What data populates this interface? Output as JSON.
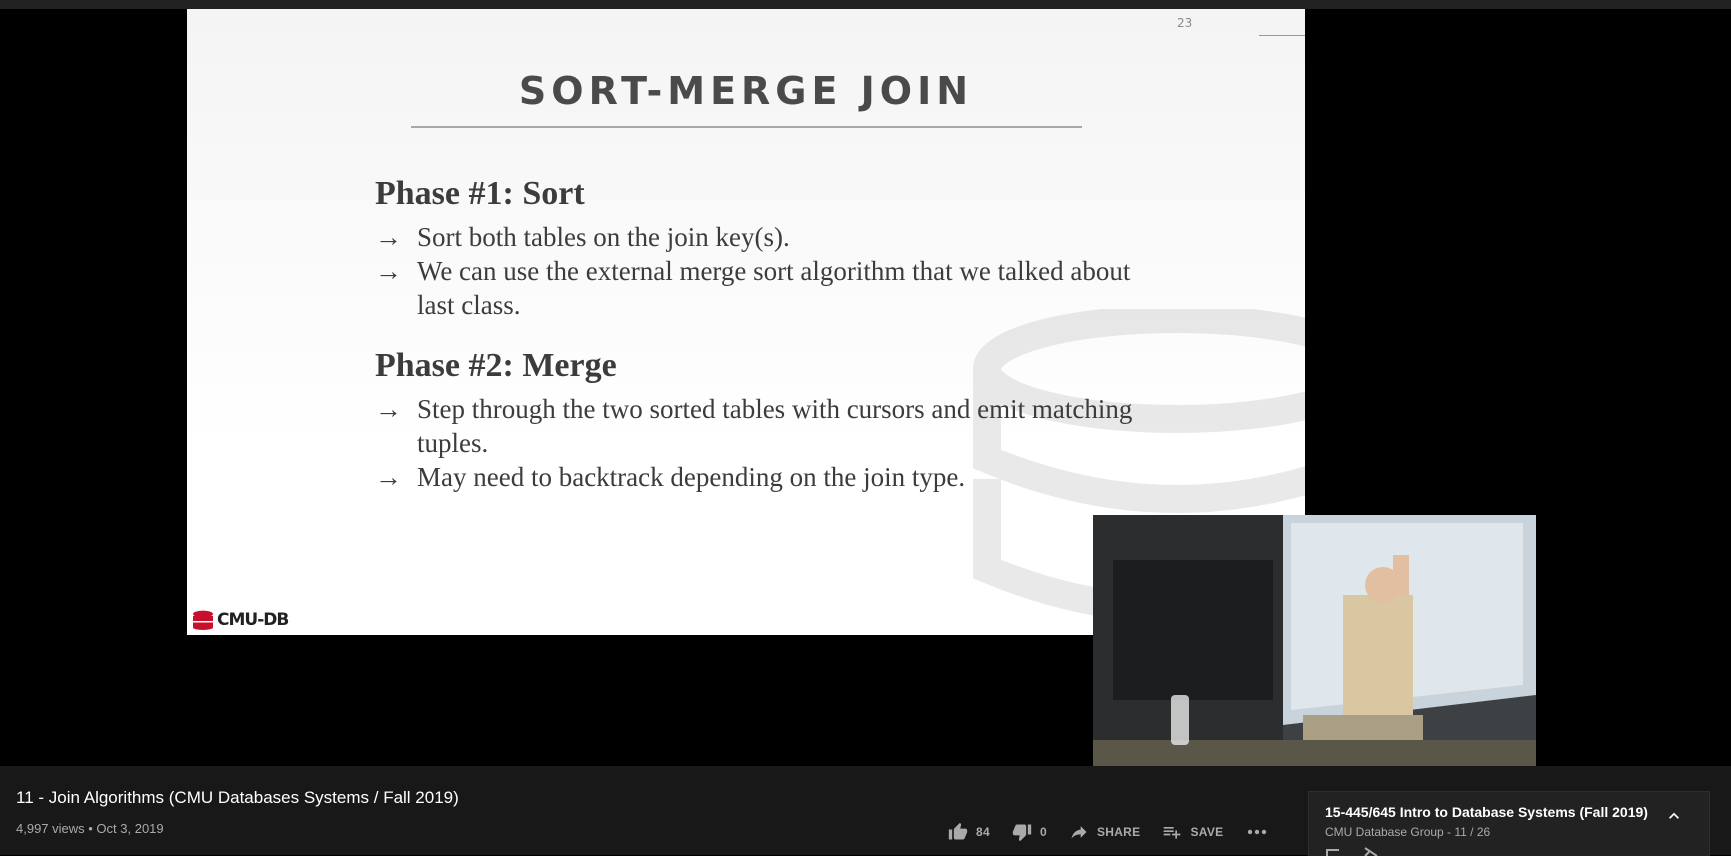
{
  "slide": {
    "number": "23",
    "title": "SORT-MERGE JOIN",
    "phase1": {
      "heading": "Phase #1: Sort",
      "bullets": [
        "Sort both tables on the join key(s).",
        "We can use the external merge sort algorithm that we talked about last class."
      ]
    },
    "phase2": {
      "heading": "Phase #2: Merge",
      "bullets": [
        "Step through the two sorted tables with cursors and emit matching tuples.",
        "May need to backtrack depending on the join type."
      ]
    },
    "arrow_glyph": "→",
    "logo_text": "CMU-DB"
  },
  "video": {
    "title": "11 - Join Algorithms (CMU Databases Systems / Fall 2019)",
    "meta": "4,997 views • Oct 3, 2019",
    "like_count": "84",
    "dislike_count": "0",
    "share_label": "SHARE",
    "save_label": "SAVE"
  },
  "playlist": {
    "title": "15-445/645 Intro to Database Systems (Fall 2019)",
    "subtitle": "CMU Database Group - 11 / 26"
  },
  "icons": {
    "like": "thumb-up-icon",
    "dislike": "thumb-down-icon",
    "share": "share-arrow-icon",
    "save": "playlist-add-icon",
    "more": "more-horizontal-icon",
    "collapse": "chevron-up-icon"
  },
  "colors": {
    "background": "#000000",
    "info_bar": "#181818",
    "slide_text": "#3c3c3c",
    "meta_text": "#aaaaaa",
    "logo_red": "#c8102e"
  }
}
